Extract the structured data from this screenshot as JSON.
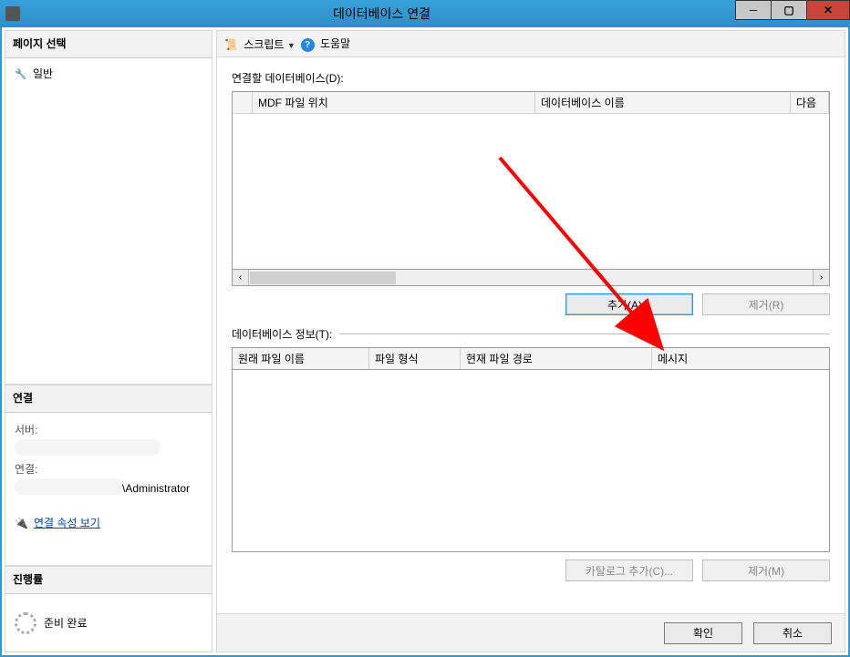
{
  "titlebar": {
    "title": "데이터베이스 연결"
  },
  "sidebar": {
    "pageSelectTitle": "페이지 선택",
    "generalItem": "일반",
    "connectionTitle": "연결",
    "serverLabel": "서버:",
    "connLabel": "연결:",
    "connValueSuffix": "\\Administrator",
    "viewPropsLink": "연결 속성 보기",
    "progressTitle": "진행률",
    "readyStatus": "준비 완료"
  },
  "toolbar": {
    "scriptLabel": "스크립트",
    "helpLabel": "도움말"
  },
  "main": {
    "attachLabel": "연결할 데이터베이스(D):",
    "cols": {
      "mdfLoc": "MDF 파일 위치",
      "dbName": "데이터베이스 이름",
      "next": "다음"
    },
    "addBtn": "추가(A)...",
    "removeBtn": "제거(R)",
    "detailsLabel": "데이터베이스 정보(T):",
    "detailCols": {
      "origName": "원래 파일 이름",
      "fileType": "파일 형식",
      "currentPath": "현재 파일 경로",
      "message": "메시지"
    },
    "addCatalogBtn": "카탈로그 추가(C)...",
    "removeMBtn": "제거(M)"
  },
  "footer": {
    "ok": "확인",
    "cancel": "취소"
  }
}
